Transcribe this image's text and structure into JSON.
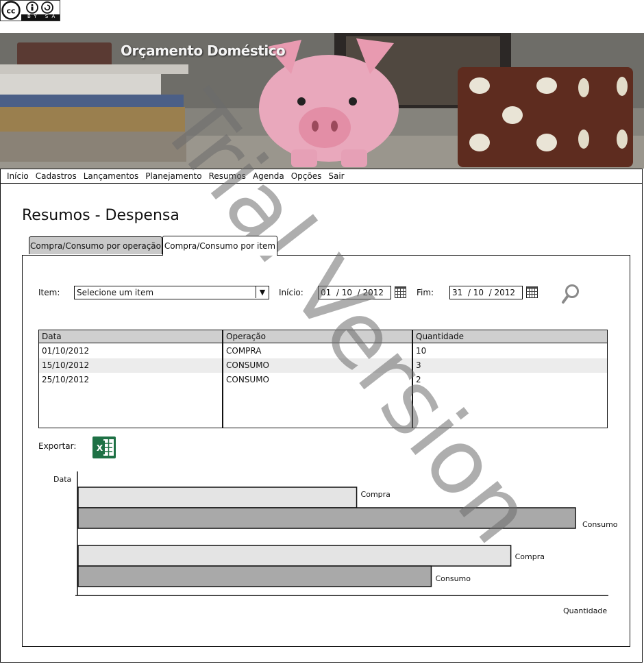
{
  "license_badge": {
    "text": "BY SA"
  },
  "header": {
    "title": "Orçamento Doméstico"
  },
  "menu": [
    "Início",
    "Cadastros",
    "Lançamentos",
    "Planejamento",
    "Resumos",
    "Agenda",
    "Opções",
    "Sair"
  ],
  "page_title": "Resumos - Despensa",
  "tabs": [
    {
      "label": "Compra/Consumo por operação",
      "active": false
    },
    {
      "label": "Compra/Consumo por item",
      "active": true
    }
  ],
  "filters": {
    "item_label": "Item:",
    "item_value": "Selecione um item",
    "start_label": "Início:",
    "start_value": "01  / 10  / 2012",
    "end_label": "Fim:",
    "end_value": "31  / 10  / 2012"
  },
  "table": {
    "headers": [
      "Data",
      "Operação",
      "Quantidade"
    ],
    "rows": [
      [
        "01/10/2012",
        "COMPRA",
        "10"
      ],
      [
        "15/10/2012",
        "CONSUMO",
        "3"
      ],
      [
        "25/10/2012",
        "CONSUMO",
        "2"
      ]
    ]
  },
  "export": {
    "label": "Exportar:",
    "icon": "excel-icon"
  },
  "watermark": "Trial Version",
  "chart_data": {
    "type": "bar",
    "orientation": "horizontal",
    "ylabel": "Data",
    "xlabel": "Quantidade",
    "bars": [
      {
        "label": "Compra",
        "value": 0.56,
        "color": "#e4e4e4"
      },
      {
        "label": "Consumo",
        "value": 1.0,
        "color": "#a9a9a9"
      },
      {
        "label": "Compra",
        "value": 0.87,
        "color": "#e4e4e4"
      },
      {
        "label": "Consumo",
        "value": 0.71,
        "color": "#a9a9a9"
      }
    ]
  }
}
